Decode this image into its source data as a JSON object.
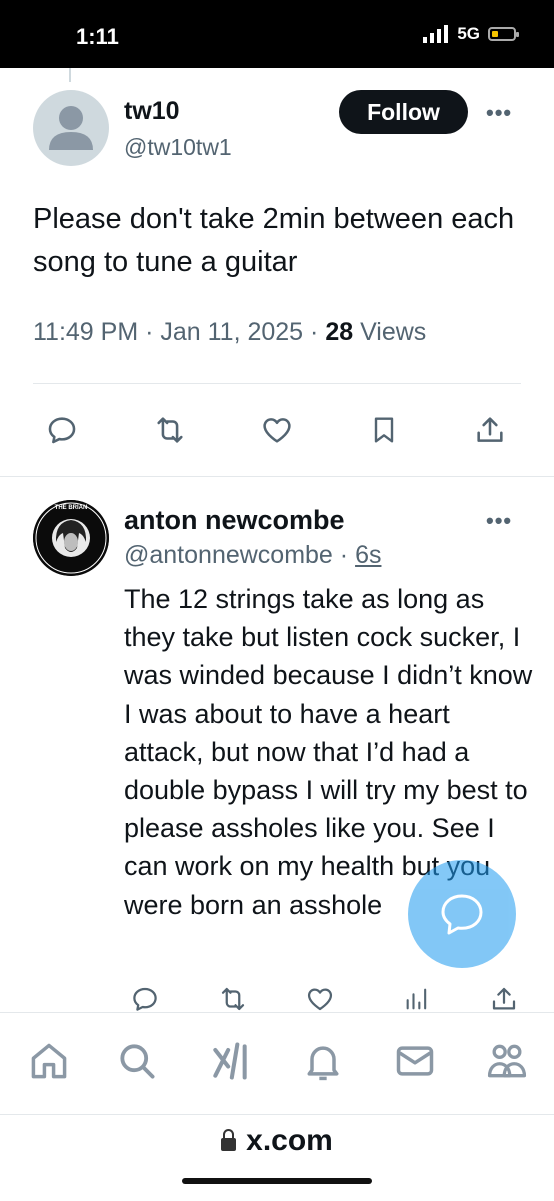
{
  "status_bar": {
    "time": "1:11",
    "network": "5G"
  },
  "main_tweet": {
    "display_name": "tw10",
    "handle": "@tw10tw1",
    "follow_label": "Follow",
    "text": "Please don't take 2min between each song to tune a guitar",
    "timestamp": "11:49 PM · Jan 11, 2025 · ",
    "views_count": "28",
    "views_label": " Views"
  },
  "reply": {
    "display_name": "anton newcombe",
    "handle": "@antonnewcombe · ",
    "time": "6s",
    "text": "The 12 strings take as long as they take but listen cock sucker, I was winded because I didn’t know I was about to have a heart attack, but now that I’d had a double bypass I will try my best to please assholes like you. See I can work on my health but you were born an asshole",
    "avatar_text": "THE BRIAN JONESTOWN MASSACRE"
  },
  "bottom_nav": {
    "items": [
      "home-icon",
      "search-icon",
      "grok-icon",
      "notifications-icon",
      "messages-icon",
      "communities-icon"
    ]
  },
  "browser": {
    "url": "x.com"
  },
  "colors": {
    "accent": "#1d9bf0",
    "text": "#0f1419",
    "secondary": "#536471",
    "divider": "#e4e8eb"
  }
}
